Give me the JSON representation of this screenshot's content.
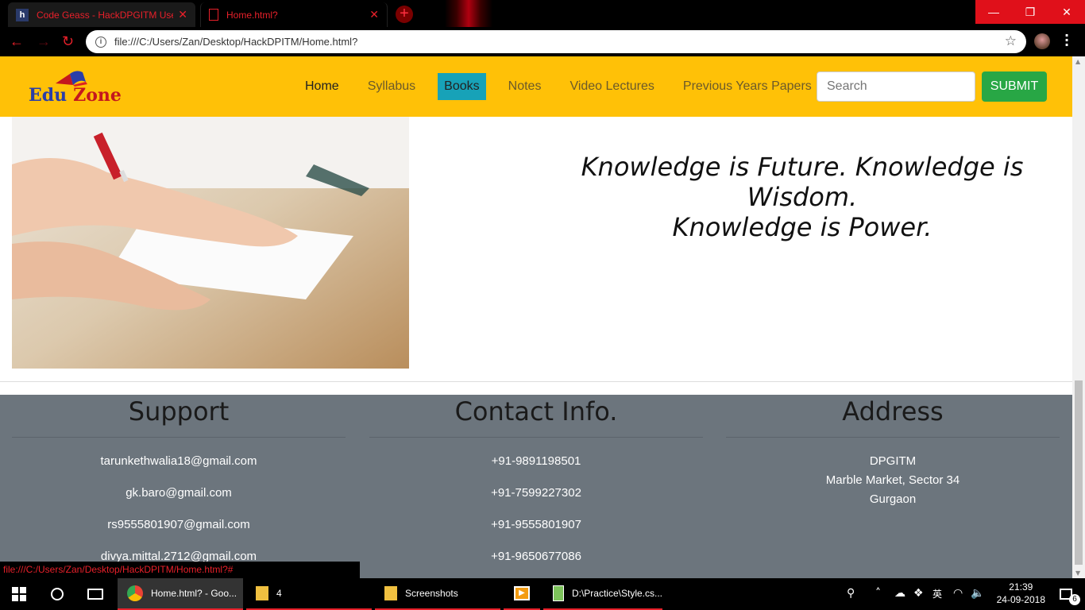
{
  "browser": {
    "tabs": [
      {
        "title": "Code Geass - HackDPGITM Users",
        "favicon": "h"
      },
      {
        "title": "Home.html?"
      }
    ],
    "new_tab": "+",
    "url": "file:///C:/Users/Zan/Desktop/HackDPITM/Home.html?",
    "status_url": "file:///C:/Users/Zan/Desktop/HackDPITM/Home.html?#",
    "accent": "#e8202a"
  },
  "site": {
    "logo": {
      "edu": "Edu",
      "zone": "Zone"
    },
    "nav": [
      "Home",
      "Syllabus",
      "Books",
      "Notes",
      "Video Lectures",
      "Previous Years Papers"
    ],
    "active_nav": "Books",
    "search": {
      "placeholder": "Search",
      "button": "SUBMIT"
    },
    "quote": {
      "line1": "Knowledge is Future. Knowledge is Wisdom.",
      "line2": "Knowledge is Power."
    },
    "colors": {
      "navbar": "#ffc107",
      "active": "#17a2b8",
      "submit": "#28a745",
      "footer": "#6c757d"
    }
  },
  "footer": {
    "support": {
      "title": "Support",
      "items": [
        "tarunkethwalia18@gmail.com",
        "gk.baro@gmail.com",
        "rs9555801907@gmail.com",
        "divya.mittal.2712@gmail.com"
      ]
    },
    "contact": {
      "title": "Contact Info.",
      "items": [
        "+91-9891198501",
        "+91-7599227302",
        "+91-9555801907",
        "+91-9650677086"
      ]
    },
    "address": {
      "title": "Address",
      "items": [
        "DPGITM",
        "Marble Market, Sector 34",
        "Gurgaon"
      ]
    }
  },
  "taskbar": {
    "items": [
      {
        "label": "Home.html? - Goo...",
        "icon": "chrome-icon"
      },
      {
        "label": "4",
        "icon": "folder-icon"
      },
      {
        "label": "Screenshots",
        "icon": "folder-icon"
      },
      {
        "label": "",
        "icon": "media-player-icon"
      },
      {
        "label": "D:\\Practice\\Style.cs...",
        "icon": "notepad-icon"
      }
    ],
    "time": "21:39",
    "date": "24-09-2018",
    "notifications": "6"
  }
}
